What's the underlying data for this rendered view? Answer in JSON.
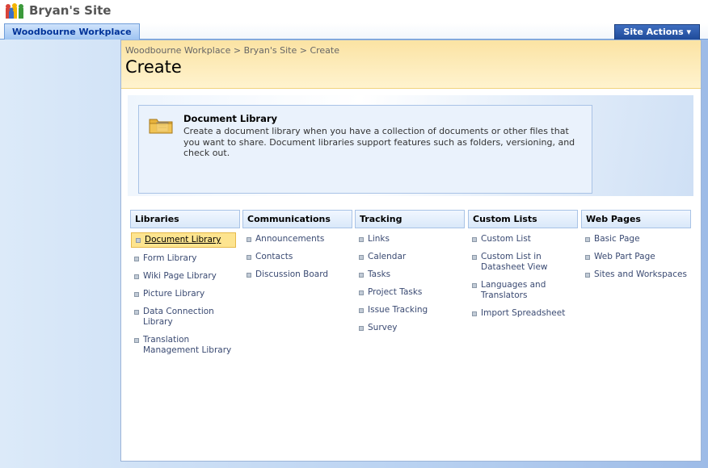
{
  "site": {
    "title": "Bryan's Site",
    "logo_icon": "people-logo-icon"
  },
  "nav": {
    "tab_label": "Woodbourne Workplace",
    "site_actions_label": "Site Actions ▾"
  },
  "breadcrumb": "Woodbourne Workplace  >  Bryan's Site  >  Create",
  "page_title": "Create",
  "description": {
    "title": "Document Library",
    "icon": "folder-icon",
    "text": "Create a document library when you have a collection of documents or other files that you want to share.  Document libraries support features such as folders, versioning, and check out."
  },
  "columns": [
    {
      "heading": "Libraries",
      "items": [
        "Document Library",
        "Form Library",
        "Wiki Page Library",
        "Picture Library",
        "Data Connection Library",
        "Translation Management Library"
      ]
    },
    {
      "heading": "Communications",
      "items": [
        "Announcements",
        "Contacts",
        "Discussion Board"
      ]
    },
    {
      "heading": "Tracking",
      "items": [
        "Links",
        "Calendar",
        "Tasks",
        "Project Tasks",
        "Issue Tracking",
        "Survey"
      ]
    },
    {
      "heading": "Custom Lists",
      "items": [
        "Custom List",
        "Custom List in Datasheet View",
        "Languages and Translators",
        "Import Spreadsheet"
      ]
    },
    {
      "heading": "Web Pages",
      "items": [
        "Basic Page",
        "Web Part Page",
        "Sites and Workspaces"
      ]
    }
  ],
  "selected_item": "Document Library",
  "colors": {
    "header_bg": "#fbe3a3",
    "link": "#3a4a72",
    "selected_bg": "#fde48f",
    "nav_accent": "#1e4a99"
  }
}
